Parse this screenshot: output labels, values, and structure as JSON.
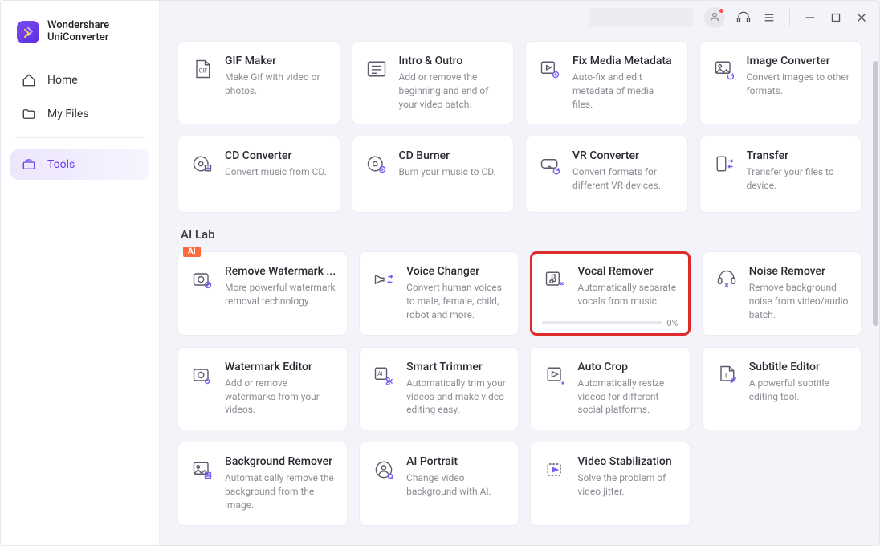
{
  "brand": {
    "line1": "Wondershare",
    "line2": "UniConverter"
  },
  "sidebar": {
    "items": [
      {
        "key": "home",
        "label": "Home"
      },
      {
        "key": "my-files",
        "label": "My Files"
      },
      {
        "key": "tools",
        "label": "Tools"
      }
    ]
  },
  "sections": [
    {
      "key": "top",
      "title": "",
      "cards": [
        {
          "key": "gif-maker",
          "title": "GIF Maker",
          "desc": "Make Gif with video or photos."
        },
        {
          "key": "intro-outro",
          "title": "Intro & Outro",
          "desc": "Add or remove the beginning and end of your video batch."
        },
        {
          "key": "fix-media-metadata",
          "title": "Fix Media Metadata",
          "desc": "Auto-fix and edit metadata of media files."
        },
        {
          "key": "image-converter",
          "title": "Image Converter",
          "desc": "Convert images to other formats."
        },
        {
          "key": "cd-converter",
          "title": "CD Converter",
          "desc": "Convert music from CD."
        },
        {
          "key": "cd-burner",
          "title": "CD Burner",
          "desc": "Burn your music to CD."
        },
        {
          "key": "vr-converter",
          "title": "VR Converter",
          "desc": "Convert formats for different VR devices."
        },
        {
          "key": "transfer",
          "title": "Transfer",
          "desc": "Transfer your files to device."
        }
      ]
    },
    {
      "key": "ai-lab",
      "title": "AI Lab",
      "cards": [
        {
          "key": "remove-watermark",
          "title": "Remove Watermark ...",
          "desc": "More powerful watermark removal technology.",
          "badge": "AI"
        },
        {
          "key": "voice-changer",
          "title": "Voice Changer",
          "desc": "Convert human voices to male, female, child, robot and more."
        },
        {
          "key": "vocal-remover",
          "title": "Vocal Remover",
          "desc": "Automatically separate vocals from music.",
          "highlight": true,
          "progress": "0%"
        },
        {
          "key": "noise-remover",
          "title": "Noise Remover",
          "desc": "Remove background noise from video/audio batch."
        },
        {
          "key": "watermark-editor",
          "title": "Watermark Editor",
          "desc": "Add or remove watermarks from your videos."
        },
        {
          "key": "smart-trimmer",
          "title": "Smart Trimmer",
          "desc": "Automatically trim your videos and make video editing easy."
        },
        {
          "key": "auto-crop",
          "title": "Auto Crop",
          "desc": "Automatically resize videos for different social platforms."
        },
        {
          "key": "subtitle-editor",
          "title": "Subtitle Editor",
          "desc": "A powerful subtitle editing tool."
        },
        {
          "key": "background-remover",
          "title": "Background Remover",
          "desc": "Automatically remove the background from the image."
        },
        {
          "key": "ai-portrait",
          "title": "AI Portrait",
          "desc": "Change video background with AI."
        },
        {
          "key": "video-stabilization",
          "title": "Video Stabilization",
          "desc": "Solve the problem of video jitter."
        }
      ]
    }
  ]
}
